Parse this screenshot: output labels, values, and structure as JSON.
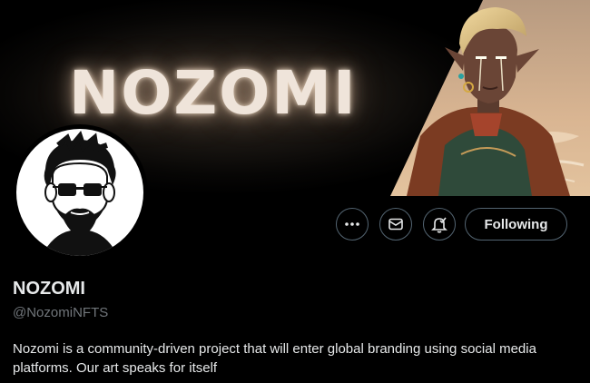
{
  "banner": {
    "title": "NOZOMI",
    "art": "anime-character-illustration"
  },
  "profile": {
    "avatar": "bearded-man-sunglasses-avatar",
    "display_name": "NOZOMI",
    "handle": "@NozomiNFTS",
    "bio": "Nozomi is a community-driven project that will enter global branding using social media platforms. Our art speaks for itself"
  },
  "actions": {
    "more_icon": "more-icon",
    "message_icon": "mail-icon",
    "notify_icon": "bell-check-icon",
    "following_label": "Following"
  },
  "colors": {
    "background": "#000000",
    "text": "#e7e9ea",
    "secondary_text": "#71767b",
    "button_border": "#536471"
  }
}
